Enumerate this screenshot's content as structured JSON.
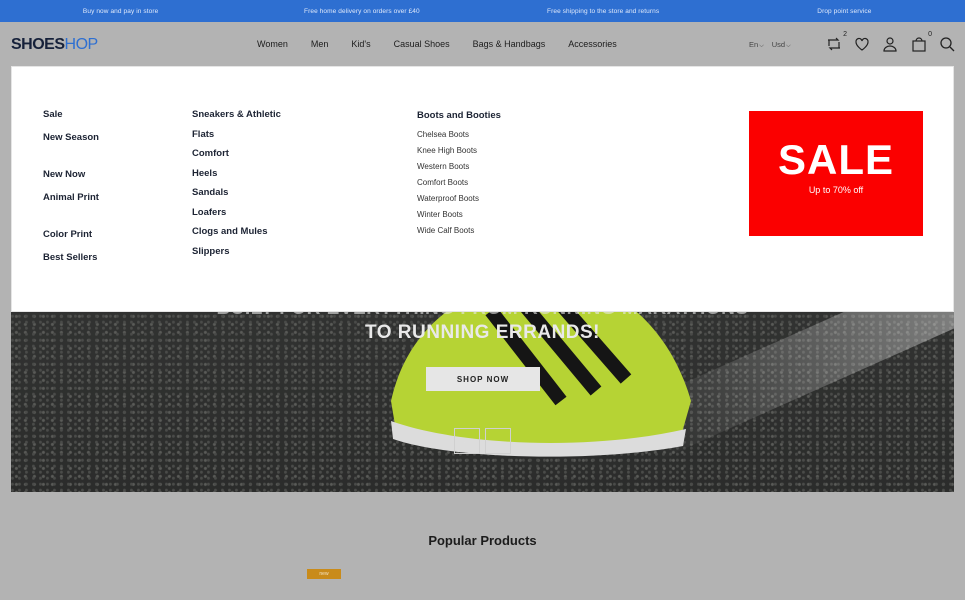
{
  "promo": [
    "Buy now and pay in store",
    "Free home delivery on orders over £40",
    "Free shipping to the store and returns",
    "Drop point service"
  ],
  "header": {
    "logo_part1": "SHOES",
    "logo_part2": "HOP",
    "nav": [
      "Women",
      "Men",
      "Kid's",
      "Casual Shoes",
      "Bags & Handbags",
      "Accessories"
    ],
    "language": "En",
    "currency": "Usd",
    "compare_count": "2",
    "cart_count": "0"
  },
  "mega_menu": {
    "col1": [
      "Sale",
      "New Season",
      "New Now",
      "Animal Print",
      "Color Print",
      "Best Sellers"
    ],
    "col2": [
      "Sneakers & Athletic",
      "Flats",
      "Comfort",
      "Heels",
      "Sandals",
      "Loafers",
      "Clogs and Mules",
      "Slippers"
    ],
    "col3_heading": "Boots and Booties",
    "col3": [
      "Chelsea Boots",
      "Knee High Boots",
      "Western Boots",
      "Comfort Boots",
      "Waterproof Boots",
      "Winter Boots",
      "Wide Calf Boots"
    ],
    "banner_title": "SALE",
    "banner_subtitle": "Up to 70% off"
  },
  "hero": {
    "line1": "BUILT FOR EVERYTHING FROM RUNNING MARATHONS",
    "line2": "TO RUNNING ERRANDS!",
    "cta": "SHOP NOW"
  },
  "popular": {
    "title": "Popular Products",
    "tag": "new"
  },
  "colors": {
    "promo_bar": "#2e6fd1",
    "sale": "#fb0000",
    "shoe": "#b6d334"
  }
}
